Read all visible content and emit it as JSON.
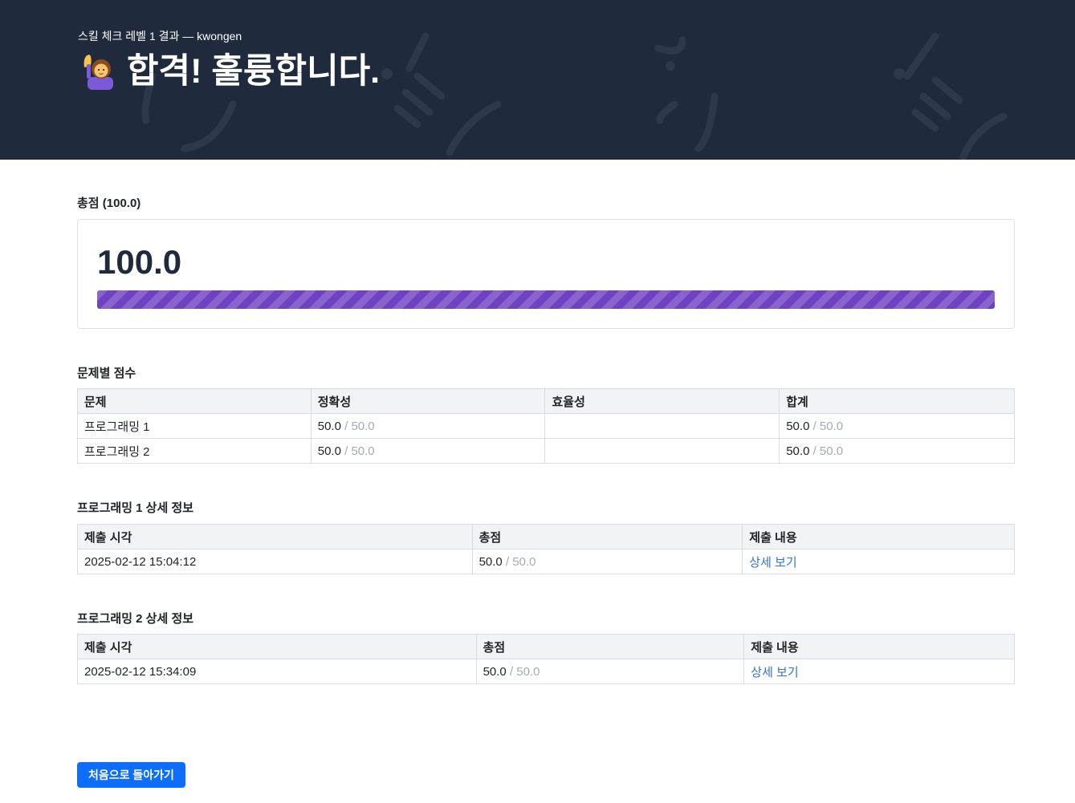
{
  "header": {
    "subtitle": "스킬 체크 레벨 1 결과 — kwongen",
    "title": "합격! 훌륭합니다.",
    "emoji_icon": "person-raising-hand-icon"
  },
  "total_score": {
    "section_title": "총점 (100.0)",
    "value": "100.0",
    "progress_fraction": 1.0,
    "bar_color": "#6f42c1"
  },
  "problems": {
    "section_title": "문제별 점수",
    "columns": [
      "문제",
      "정확성",
      "효율성",
      "합계"
    ],
    "rows": [
      {
        "name": "프로그래밍 1",
        "accuracy": "50.0",
        "accuracy_max": "/ 50.0",
        "efficiency": "",
        "total": "50.0",
        "total_max": "/ 50.0"
      },
      {
        "name": "프로그래밍 2",
        "accuracy": "50.0",
        "accuracy_max": "/ 50.0",
        "efficiency": "",
        "total": "50.0",
        "total_max": "/ 50.0"
      }
    ]
  },
  "details": [
    {
      "section_title": "프로그래밍 1 상세 정보",
      "columns": [
        "제출 시각",
        "총점",
        "제출 내용"
      ],
      "submitted_at": "2025-02-12 15:04:12",
      "score": "50.0",
      "score_max": "/ 50.0",
      "link_label": "상세 보기"
    },
    {
      "section_title": "프로그래밍 2 상세 정보",
      "columns": [
        "제출 시각",
        "총점",
        "제출 내용"
      ],
      "submitted_at": "2025-02-12 15:34:09",
      "score": "50.0",
      "score_max": "/ 50.0",
      "link_label": "상세 보기"
    }
  ],
  "back_button": {
    "label": "처음으로 돌아가기"
  },
  "colors": {
    "header_bg": "#1f2a3c",
    "accent": "#0d6efd",
    "link": "#2f73d9"
  }
}
